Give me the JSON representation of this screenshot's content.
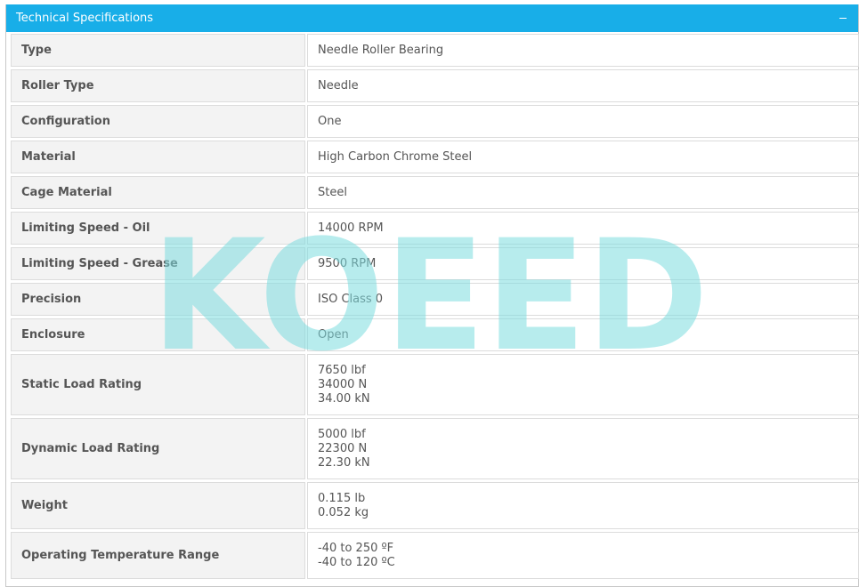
{
  "panel": {
    "title": "Technical Specifications",
    "collapse_icon": "minus-icon"
  },
  "specs": [
    {
      "label": "Type",
      "values": [
        "Needle Roller Bearing"
      ]
    },
    {
      "label": "Roller Type",
      "values": [
        "Needle"
      ]
    },
    {
      "label": "Configuration",
      "values": [
        "One"
      ]
    },
    {
      "label": "Material",
      "values": [
        "High Carbon Chrome Steel"
      ]
    },
    {
      "label": "Cage Material",
      "values": [
        "Steel"
      ]
    },
    {
      "label": "Limiting Speed - Oil",
      "values": [
        "14000 RPM"
      ]
    },
    {
      "label": "Limiting Speed - Grease",
      "values": [
        "9500 RPM"
      ]
    },
    {
      "label": "Precision",
      "values": [
        "ISO Class 0"
      ]
    },
    {
      "label": "Enclosure",
      "values": [
        "Open"
      ]
    },
    {
      "label": "Static Load Rating",
      "values": [
        "7650 lbf",
        "34000 N",
        "34.00 kN"
      ]
    },
    {
      "label": "Dynamic Load Rating",
      "values": [
        "5000 lbf",
        "22300 N",
        "22.30 kN"
      ]
    },
    {
      "label": "Weight",
      "values": [
        "0.115 lb",
        "0.052 kg"
      ]
    },
    {
      "label": "Operating Temperature Range",
      "values": [
        "-40 to 250 ºF",
        "-40 to 120 ºC"
      ]
    }
  ],
  "watermark": {
    "text": "KOEED",
    "color": "#7ddde0"
  }
}
